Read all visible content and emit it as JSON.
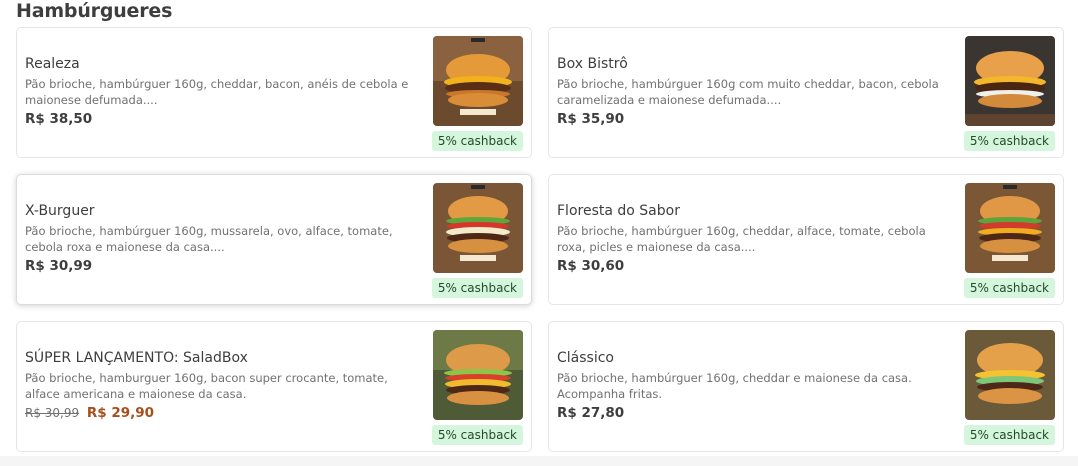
{
  "section": {
    "title": "Hambúrgueres"
  },
  "cashback_label": "5% cashback",
  "colors": {
    "cashback_bg": "#d6f5dd",
    "promo_price": "#a6501c",
    "text": "#3e3e3e",
    "muted": "#717171"
  },
  "items": [
    {
      "name": "Realeza",
      "description": "Pão brioche, hambúrguer 160g, cheddar, bacon, anéis de cebola e maionese defumada....",
      "old_price": "",
      "price": "R$ 38,50",
      "image_icon": "burger-photo"
    },
    {
      "name": "Box Bistrô",
      "description": "Pão brioche, hambúrguer 160g com muito cheddar, bacon, cebola caramelizada e maionese defumada....",
      "old_price": "",
      "price": "R$ 35,90",
      "image_icon": "burger-photo"
    },
    {
      "name": "X-Burguer",
      "description": "Pão brioche, hambúrguer 160g, mussarela, ovo, alface, tomate, cebola roxa e maionese da casa....",
      "old_price": "",
      "price": "R$ 30,99",
      "image_icon": "burger-photo"
    },
    {
      "name": "Floresta do Sabor",
      "description": "Pão brioche, hambúrguer 160g, cheddar, alface, tomate, cebola roxa, picles e maionese da casa....",
      "old_price": "",
      "price": "R$ 30,60",
      "image_icon": "burger-photo"
    },
    {
      "name": "SÚPER LANÇAMENTO: SaladBox",
      "description": "Pão brioche, hamburguer 160g, bacon super crocante, tomate, alface americana e maionese da casa.",
      "old_price": "R$ 30,99",
      "price": "R$ 29,90",
      "image_icon": "burger-photo"
    },
    {
      "name": "Clássico",
      "description": "Pão brioche, hambúrguer 160g, cheddar e maionese da casa. Acompanha fritas.",
      "old_price": "",
      "price": "R$ 27,80",
      "image_icon": "burger-photo"
    }
  ]
}
